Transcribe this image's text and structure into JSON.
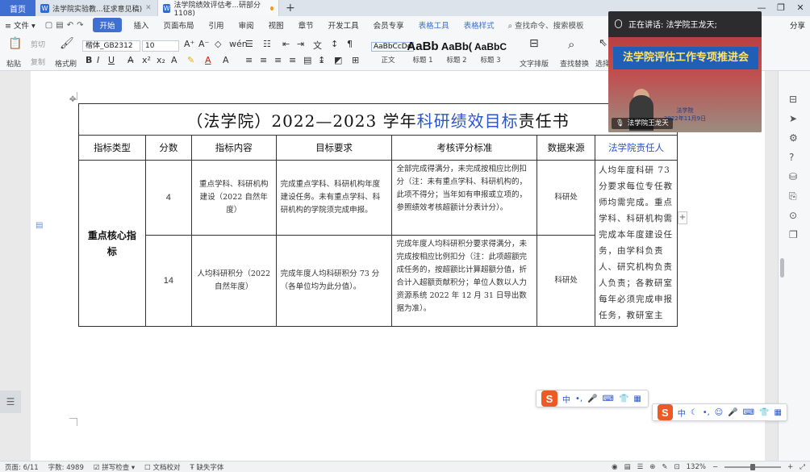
{
  "tabbar": {
    "home": "首页",
    "tabs": [
      {
        "title": "法学院实验教...征求意见稿)",
        "active": false
      },
      {
        "title": "法学院绩效评估考...研部分1108)",
        "active": true
      }
    ]
  },
  "menubar": {
    "file": "文件",
    "items": [
      "开始",
      "插入",
      "页面布局",
      "引用",
      "审阅",
      "视图",
      "章节",
      "开发工具",
      "会员专享",
      "表格工具",
      "表格样式"
    ],
    "search": "查找命令、搜索模板",
    "share": "分享"
  },
  "ribbon": {
    "format_painter": "格式刷",
    "paste": "粘贴",
    "cut": "剪切",
    "copy": "复制",
    "font_name": "楷体_GB2312",
    "font_size": "10",
    "styles": [
      {
        "sample": "AaBbCcDd",
        "caption": "正文"
      },
      {
        "sample": "AaBb",
        "caption": "标题 1"
      },
      {
        "sample": "AaBb(",
        "caption": "标题 2"
      },
      {
        "sample": "AaBbC(",
        "caption": "标题 3"
      }
    ],
    "text_layout": "文字排版",
    "find_replace": "查找替换",
    "select": "选择"
  },
  "document": {
    "title_prefix": "（法学院）2022—2023 学年",
    "title_highlight": "科研绩效目标",
    "title_suffix": "责任书",
    "headers": [
      "指标类型",
      "分数",
      "指标内容",
      "目标要求",
      "考核评分标准",
      "数据来源",
      "法学院责任人"
    ],
    "category": "重点核心指标",
    "rows": [
      {
        "score": "4",
        "content": "重点学科、科研机构建设（2022 自然年度）",
        "requirement": "完成重点学科、科研机构年度建设任务。未有重点学科、科研机构的学院须完成申报。",
        "criteria": "全部完成得满分，未完成按相应比例扣分（注：未有重点学科、科研机构的，此项不得分；当年如有申报或立项的，参照绩效考核超额计分表计分）。",
        "source": "科研处"
      },
      {
        "score": "14",
        "content": "人均科研积分（2022 自然年度）",
        "requirement": "完成年度人均科研积分 73 分（各单位均为此分值）。",
        "criteria": "完成年度人均科研积分要求得满分，未完成按相应比例扣分（注：此项超额完成任务的，按超额比计算超额分值，折合计入超额贡献积分；单位人数以人力资源系统 2022 年 12 月 31 日导出数据为准）。",
        "source": "科研处"
      }
    ],
    "responsible_text": "人均年度科研 73 分要求每位专任教师均需完成。重点学科、科研机构需完成本年度建设任务，由学科负责人、研究机构负责人负责；各教研室每年必须完成申报任务，教研室主"
  },
  "video": {
    "speaking_label": "正在讲话: 法学院王龙天;",
    "banner": "法学院评估工作专项推进会",
    "org": "法学院",
    "date": "2022年11月9日",
    "name_tag": "法学院王龙天"
  },
  "ime": {
    "items": [
      "中",
      "•,",
      "☺"
    ]
  },
  "statusbar": {
    "page": "页面: 6/11",
    "words": "字数: 4989",
    "spell": "拼写检查",
    "proofread": "文档校对",
    "missing_font": "缺失字体",
    "zoom": "132%"
  }
}
